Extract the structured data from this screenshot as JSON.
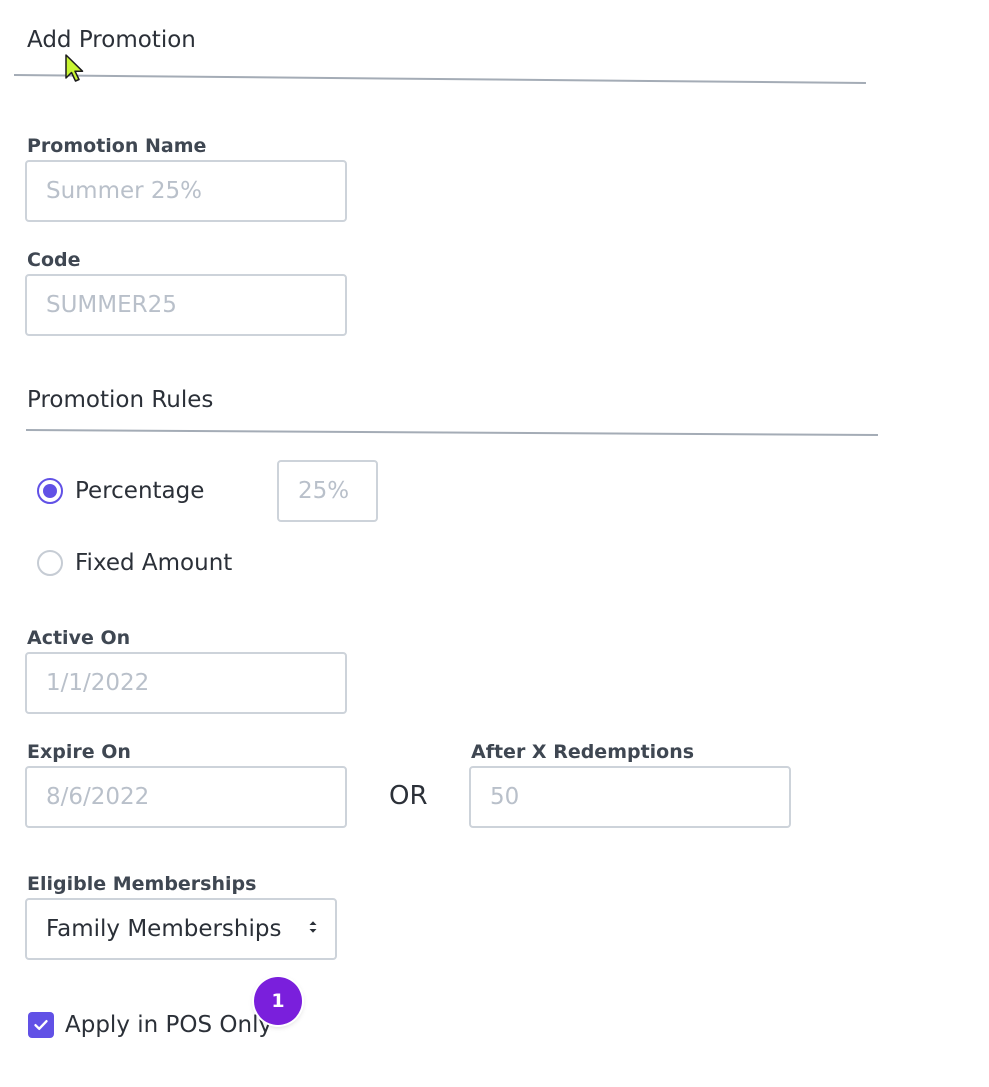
{
  "add_promotion": {
    "title": "Add Promotion",
    "promotion_name": {
      "label": "Promotion Name",
      "value": "",
      "placeholder": "Summer 25%"
    },
    "code": {
      "label": "Code",
      "value": "",
      "placeholder": "SUMMER25"
    }
  },
  "promotion_rules": {
    "title": "Promotion Rules",
    "discount_type": {
      "options": [
        {
          "label": "Percentage",
          "selected": true
        },
        {
          "label": "Fixed Amount",
          "selected": false
        }
      ],
      "percentage_input": {
        "value": "",
        "placeholder": "25%"
      }
    },
    "active_on": {
      "label": "Active On",
      "value": "",
      "placeholder": "1/1/2022"
    },
    "expire_on": {
      "label": "Expire On",
      "value": "",
      "placeholder": "8/6/2022"
    },
    "or_text": "OR",
    "after_x_redemptions": {
      "label": "After X Redemptions",
      "value": "",
      "placeholder": "50"
    },
    "eligible_memberships": {
      "label": "Eligible Memberships",
      "selected": "Family Memberships",
      "icon": "select-arrows-icon"
    },
    "apply_in_pos_only": {
      "label": "Apply in POS Only",
      "checked": true,
      "icon": "checkmark-icon"
    }
  },
  "notification_badge": {
    "count": "1"
  },
  "colors": {
    "accent": "#6151e6",
    "badge": "#7a1fdc",
    "divider": "#a4acb6",
    "input_border": "#cdd3da",
    "placeholder": "#b9c0ca",
    "label": "#3f4752"
  }
}
